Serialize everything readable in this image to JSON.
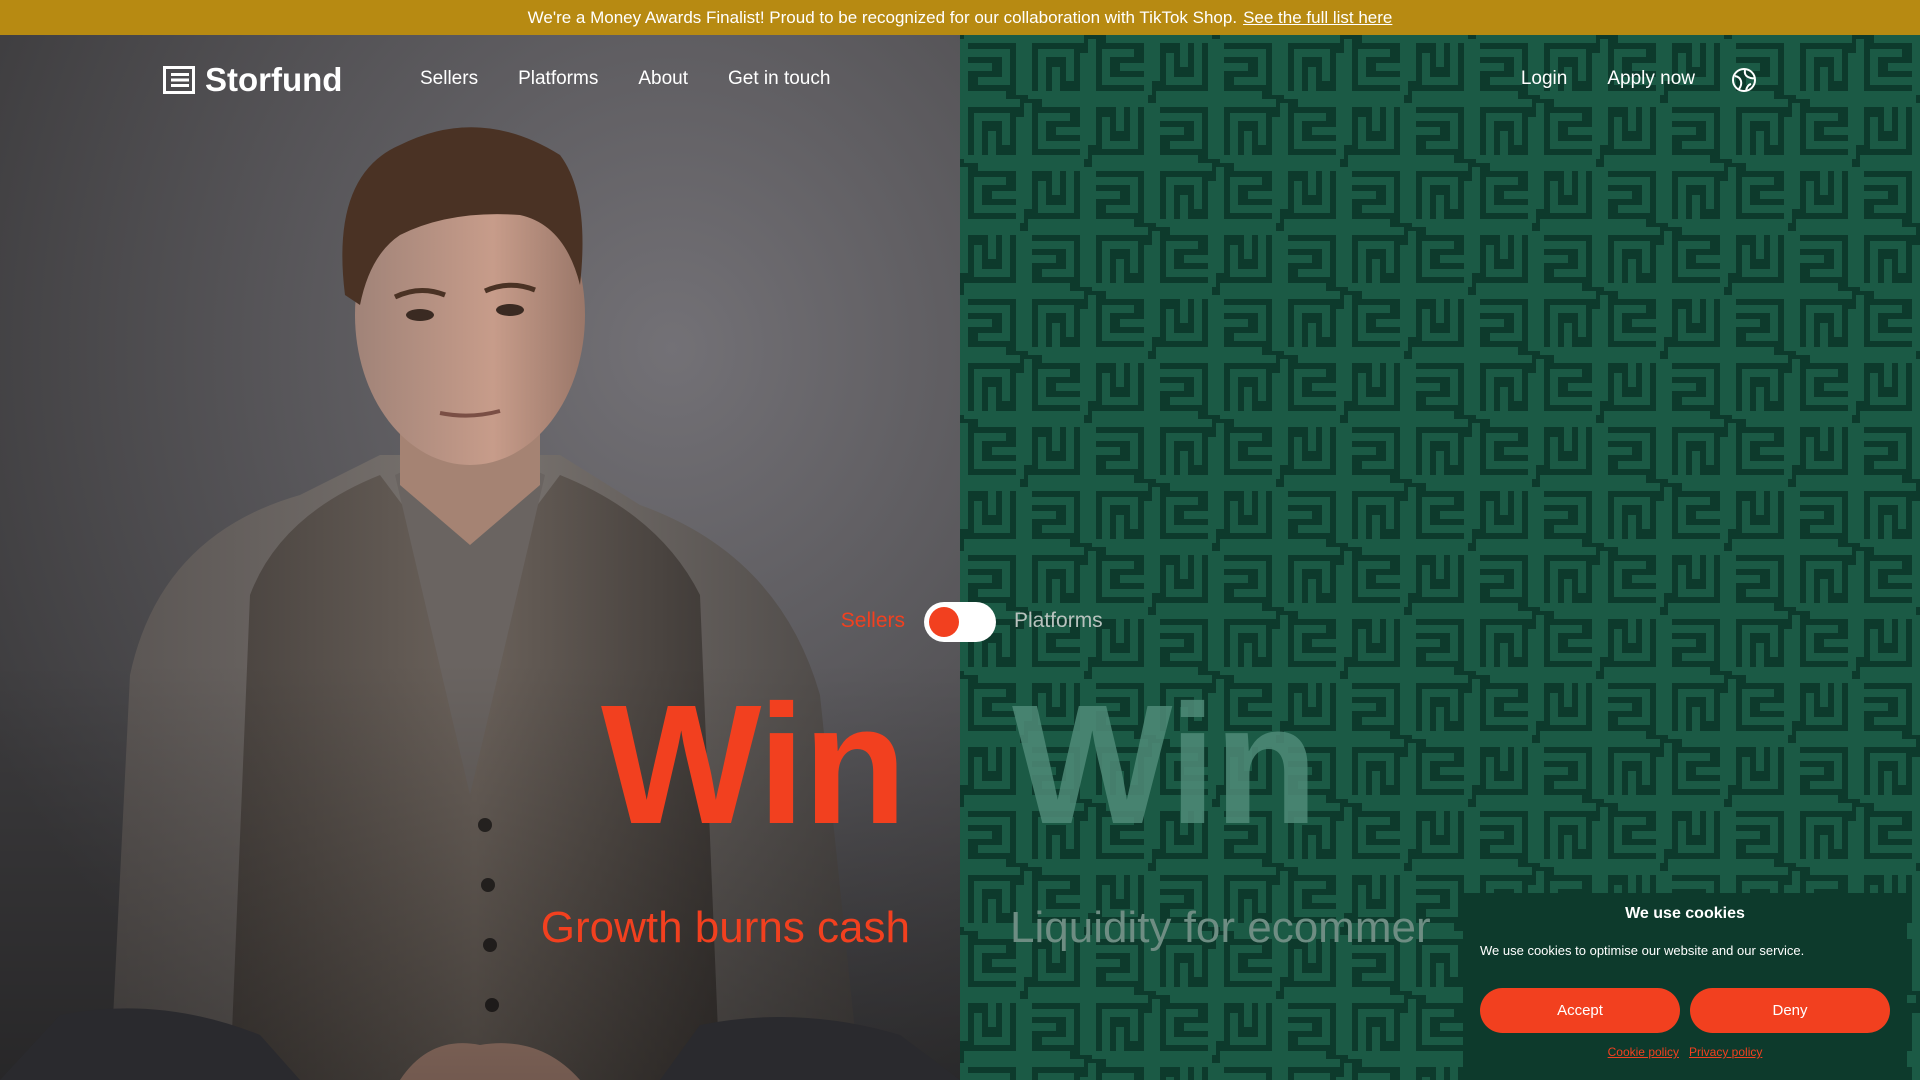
{
  "announcement": {
    "text": "We're a Money Awards Finalist! Proud to be recognized for our collaboration with TikTok Shop.",
    "link": "See the full list here"
  },
  "header": {
    "logo_text": "Storfund",
    "nav_left": [
      "Sellers",
      "Platforms",
      "About",
      "Get in touch"
    ],
    "nav_right": [
      "Login",
      "Apply now"
    ],
    "globe_icon": "globe-icon"
  },
  "toggle": {
    "left_label": "Sellers",
    "right_label": "Platforms",
    "state": "Sellers"
  },
  "hero": {
    "left_heading": "Win",
    "left_subheading": "Growth burns cash",
    "right_heading": "Win",
    "right_subheading": "Liquidity for ecommer"
  },
  "cookie": {
    "title": "We use cookies",
    "text": "We use cookies to optimise our website and our service.",
    "accept_label": "Accept",
    "deny_label": "Deny",
    "cookie_policy": "Cookie policy",
    "privacy_policy": "Privacy policy"
  },
  "colors": {
    "announce_bg": "#b78a12",
    "accent": "#f2401f",
    "dark_green": "#0d3a2c",
    "pattern_green": "#1b5a45"
  }
}
